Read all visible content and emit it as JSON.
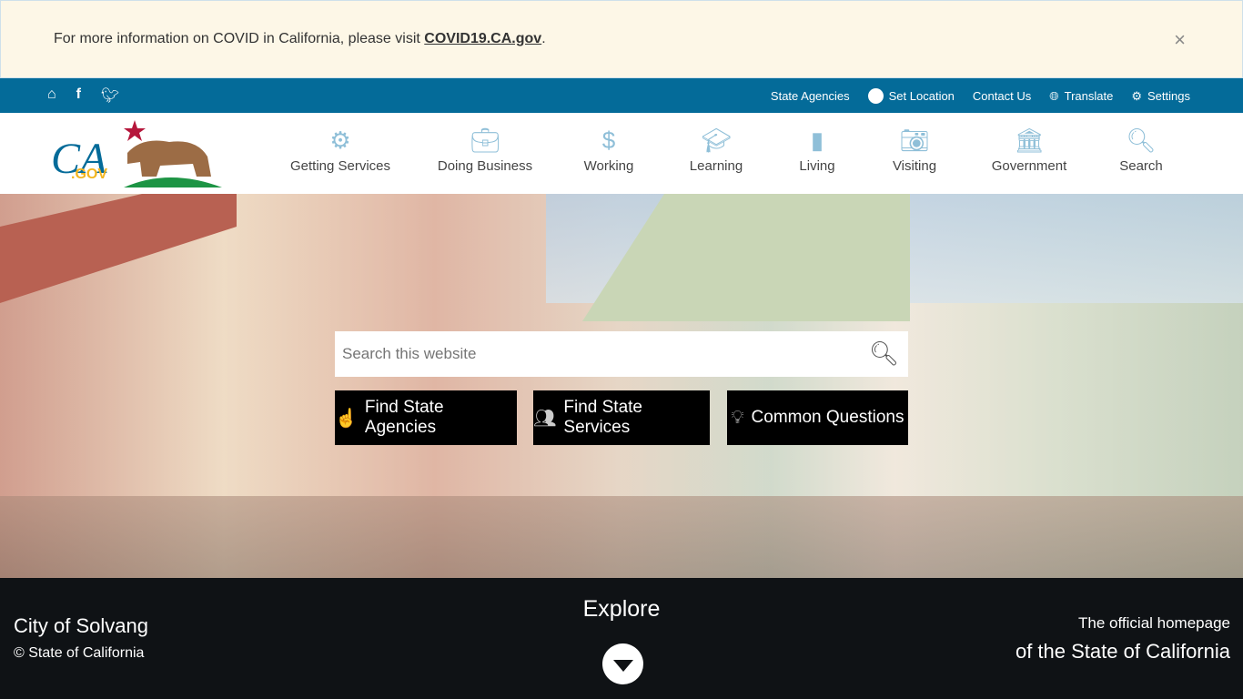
{
  "alert": {
    "text": "For more information on COVID in California, please visit ",
    "link": "COVID19.CA.gov",
    "suffix": ".",
    "close": "×"
  },
  "utility": {
    "left_icons": [
      "home-icon",
      "facebook-icon",
      "twitter-icon"
    ],
    "links": [
      "State Agencies",
      "Set Location",
      "Contact Us",
      "Translate",
      "Settings"
    ]
  },
  "logo": {
    "text": "CA.GOV"
  },
  "nav": [
    {
      "label": "Getting Services",
      "icon": "gears-icon"
    },
    {
      "label": "Doing Business",
      "icon": "briefcase-icon"
    },
    {
      "label": "Working",
      "icon": "lightbulb-dollar-icon"
    },
    {
      "label": "Learning",
      "icon": "graduation-cap-icon"
    },
    {
      "label": "Living",
      "icon": "california-icon"
    },
    {
      "label": "Visiting",
      "icon": "camera-icon"
    },
    {
      "label": "Government",
      "icon": "capitol-icon"
    },
    {
      "label": "Search",
      "icon": "search-icon"
    }
  ],
  "hero": {
    "search_placeholder": "Search this website",
    "buttons": [
      "Find State Agencies",
      "Find State Services",
      "Common Questions"
    ]
  },
  "footer": {
    "city": "City of Solvang",
    "copyright": "© State of California",
    "explore": "Explore",
    "official_line1": "The official homepage",
    "official_line2": "of the State of California"
  },
  "colors": {
    "utility_bar": "#046b99",
    "alert_bg": "#fdf7e7",
    "footer_bg": "#0f1215",
    "nav_icon": "#8fbfd8"
  }
}
